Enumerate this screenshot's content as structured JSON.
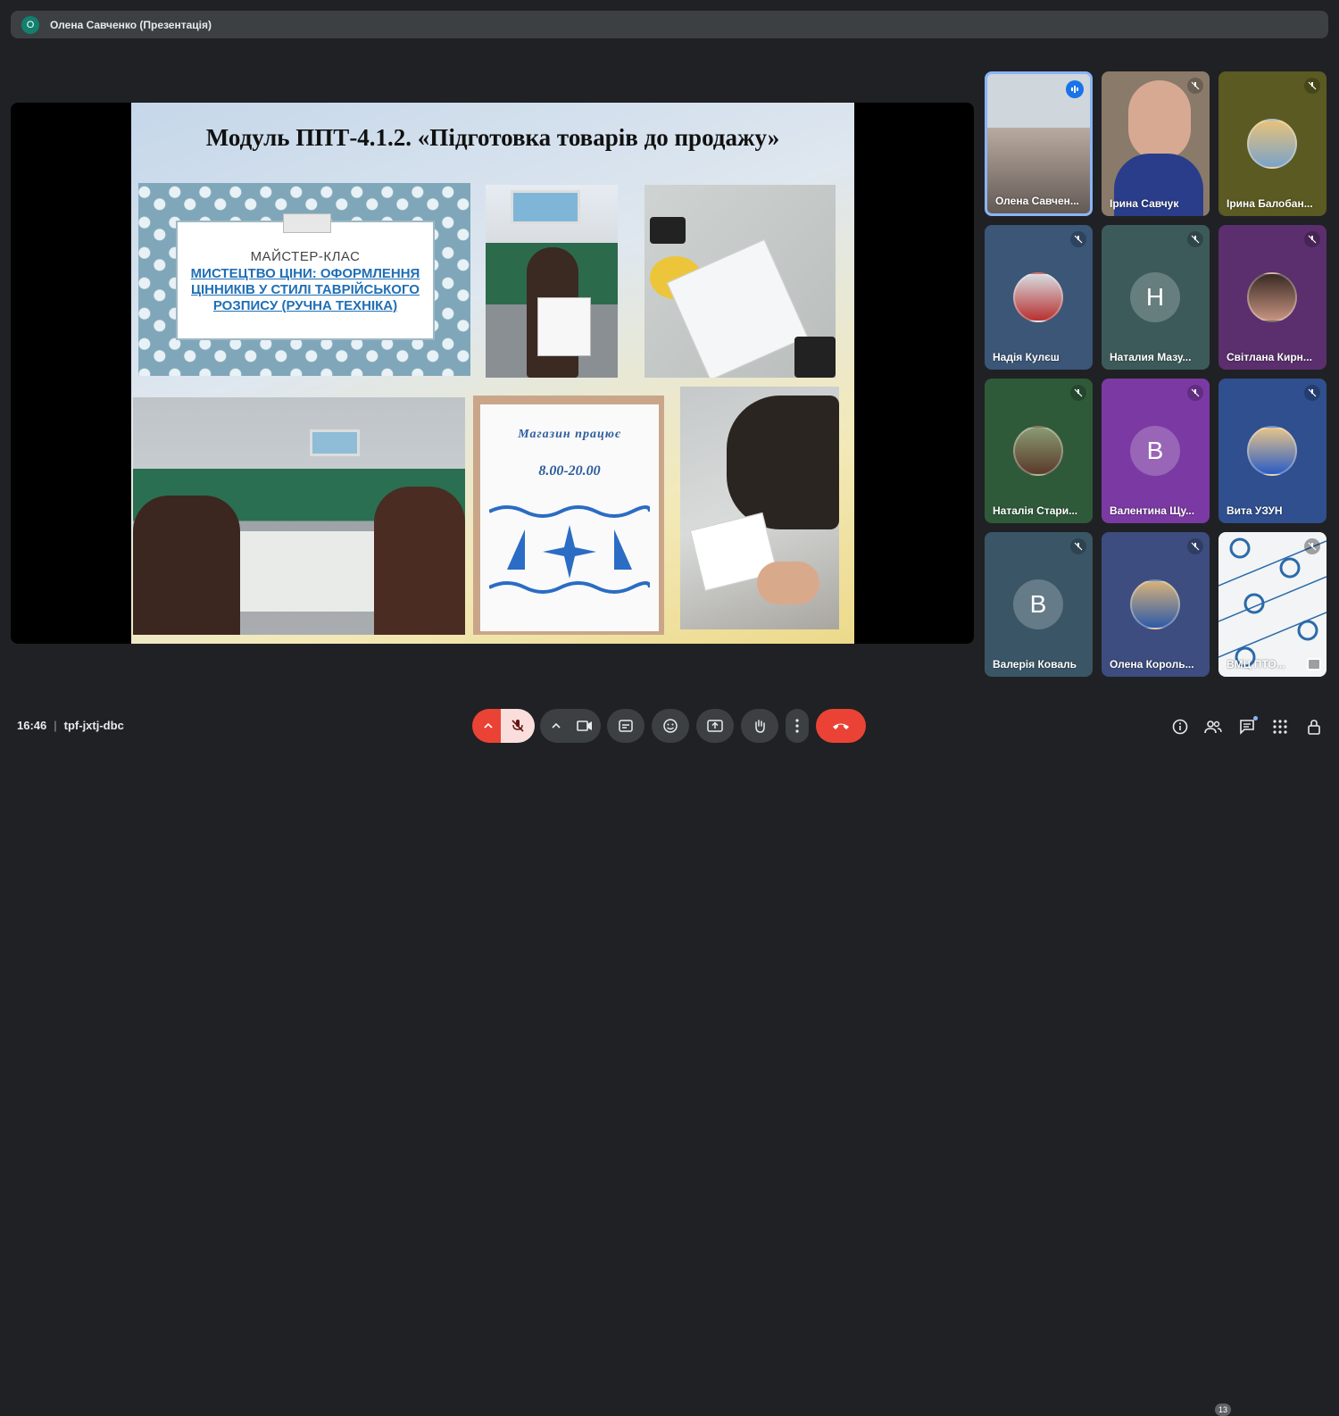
{
  "topbar": {
    "presenter_initial": "О",
    "presenter_label": "Олена Савченко (Презентація)"
  },
  "slide": {
    "title": "Модуль ППТ-4.1.2. «Підготовка товарів до продажу»",
    "masterclass_label": "МАЙСТЕР-КЛАС",
    "masterclass_text": "МИСТЕЦТВО ЦІНИ: ОФОРМЛЕННЯ ЦІННИКІВ У СТИЛІ ТАВРІЙСЬКОГО РОЗПИСУ (РУЧНА ТЕХНІКА)",
    "shop_title": "Магазин працює",
    "shop_hours": "8.00-20.00"
  },
  "participants": [
    {
      "name": "Олена Савчен...",
      "kind": "video",
      "bg": "#cfd6dc",
      "speaking": true
    },
    {
      "name": "Ірина Савчук",
      "kind": "video",
      "bg": "#8a7a6a",
      "speaking": false
    },
    {
      "name": "Ірина Балобан...",
      "kind": "photo",
      "bg": "#5a5a22",
      "speaking": false
    },
    {
      "name": "Надія Кулєш",
      "kind": "photo",
      "bg": "#3b5677",
      "speaking": false
    },
    {
      "name": "Наталия Мазу...",
      "kind": "letter",
      "letter": "Н",
      "bg": "#3d5a5a",
      "speaking": false
    },
    {
      "name": "Світлана Кирн...",
      "kind": "photo",
      "bg": "#5b2f6e",
      "speaking": false
    },
    {
      "name": "Наталія Стари...",
      "kind": "photo",
      "bg": "#2f5a3a",
      "speaking": false
    },
    {
      "name": "Валентина Щу...",
      "kind": "letter",
      "letter": "В",
      "bg": "#7b3aa3",
      "speaking": false
    },
    {
      "name": "Вита УЗУН",
      "kind": "photo",
      "bg": "#2f4f8f",
      "speaking": false
    },
    {
      "name": "Валерія Коваль",
      "kind": "letter",
      "letter": "В",
      "bg": "#3a5666",
      "speaking": false
    },
    {
      "name": "Олена Король...",
      "kind": "photo",
      "bg": "#3d4d80",
      "speaking": false
    },
    {
      "name": "ВМЦ ПТО...",
      "kind": "logo",
      "bg": "#f2f4f6",
      "speaking": false
    }
  ],
  "bottom": {
    "time": "16:46",
    "meeting_code": "tpf-jxtj-dbc",
    "participants_count": "13"
  },
  "icons": {
    "mic": "mic-off-icon",
    "camera": "camera-icon",
    "captions": "captions-icon",
    "emoji": "emoji-icon",
    "present": "present-icon",
    "hand": "raise-hand-icon",
    "more": "more-options-icon",
    "leave": "leave-call-icon",
    "info": "info-icon",
    "people": "people-icon",
    "chat": "chat-icon",
    "activities": "activities-icon",
    "lock": "host-controls-icon"
  },
  "colors": {
    "leave": "#ea4335",
    "mic_off": "#f9dedc",
    "accent": "#8ab4f8"
  }
}
